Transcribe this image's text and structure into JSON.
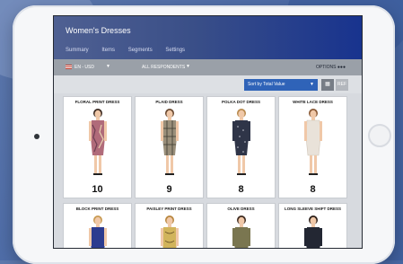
{
  "header": {
    "title": "Women's Dresses",
    "tabs": [
      "Summary",
      "Items",
      "Segments",
      "Settings"
    ]
  },
  "filter_bar": {
    "language": "EN - USD",
    "respondents": "ALL RESPONDENTS",
    "options": "OPTIONS"
  },
  "toolbar": {
    "sort": "Sort by Total Value",
    "ref": "REF"
  },
  "cards": [
    {
      "name": "FLORAL PRINT DRESS",
      "count": "10"
    },
    {
      "name": "PLAID DRESS",
      "count": "9"
    },
    {
      "name": "POLKA DOT DRESS",
      "count": "8"
    },
    {
      "name": "WHITE LACE DRESS",
      "count": "8"
    },
    {
      "name": "BLOCK PRINT DRESS",
      "count": ""
    },
    {
      "name": "PAISLEY PRINT DRESS",
      "count": ""
    },
    {
      "name": "OLIVE DRESS",
      "count": ""
    },
    {
      "name": "LONG SLEEVE SHIFT DRESS",
      "count": ""
    }
  ],
  "colors": {
    "header_start": "#4f6092",
    "header_end": "#18338e",
    "sort_button": "#2f63b8",
    "dress_floral": "#b06b7a",
    "dress_plaid": "#9a8f7a",
    "dress_polka": "#2f3548",
    "dress_lace": "#e9e2d9",
    "dress_block": "#2c3c8f",
    "dress_paisley": "#d1b45b",
    "dress_olive": "#7a7650",
    "dress_long": "#232733"
  }
}
